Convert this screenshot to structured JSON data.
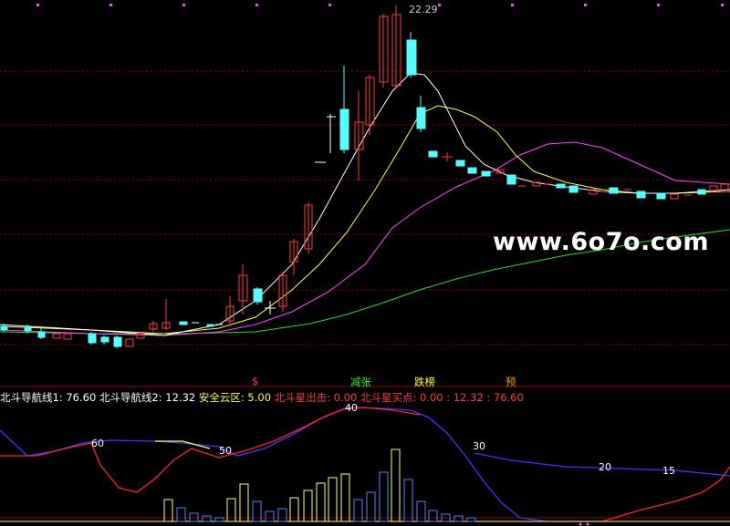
{
  "price_panel": {
    "peak_label": "22.29",
    "watermark": "www.6o7o.com",
    "colors": {
      "up": "#ff3b3b",
      "down": "#54ffff",
      "ma_white": "#ffffff",
      "ma_yellow": "#ffff44",
      "ma_magenta": "#ff44ff",
      "ma_green": "#22dd22",
      "grid": "#8b0000"
    }
  },
  "signals": [
    {
      "label": "$",
      "color": "#ff3b3b"
    },
    {
      "label": "减张",
      "color": "#22ee22"
    },
    {
      "label": "跌榜",
      "color": "#ffff44"
    },
    {
      "label": "预",
      "color": "#ff9900"
    }
  ],
  "indicator": {
    "items": [
      {
        "text": "北斗导航线1: 76.60",
        "color": "#ffffff"
      },
      {
        "text": "北斗导航线2: 12.32",
        "color": "#ffffff"
      },
      {
        "text": "安全云区: 5.00",
        "color": "#ffff44"
      },
      {
        "text": "北斗星出击: 0.00",
        "color": "#ff3b3b"
      },
      {
        "text": "北斗星买点: 0.00 : 12.32 : 76.60",
        "color": "#ff3b3b"
      }
    ],
    "level_labels": [
      "60",
      "50",
      "40",
      "30",
      "20",
      "15"
    ]
  }
}
